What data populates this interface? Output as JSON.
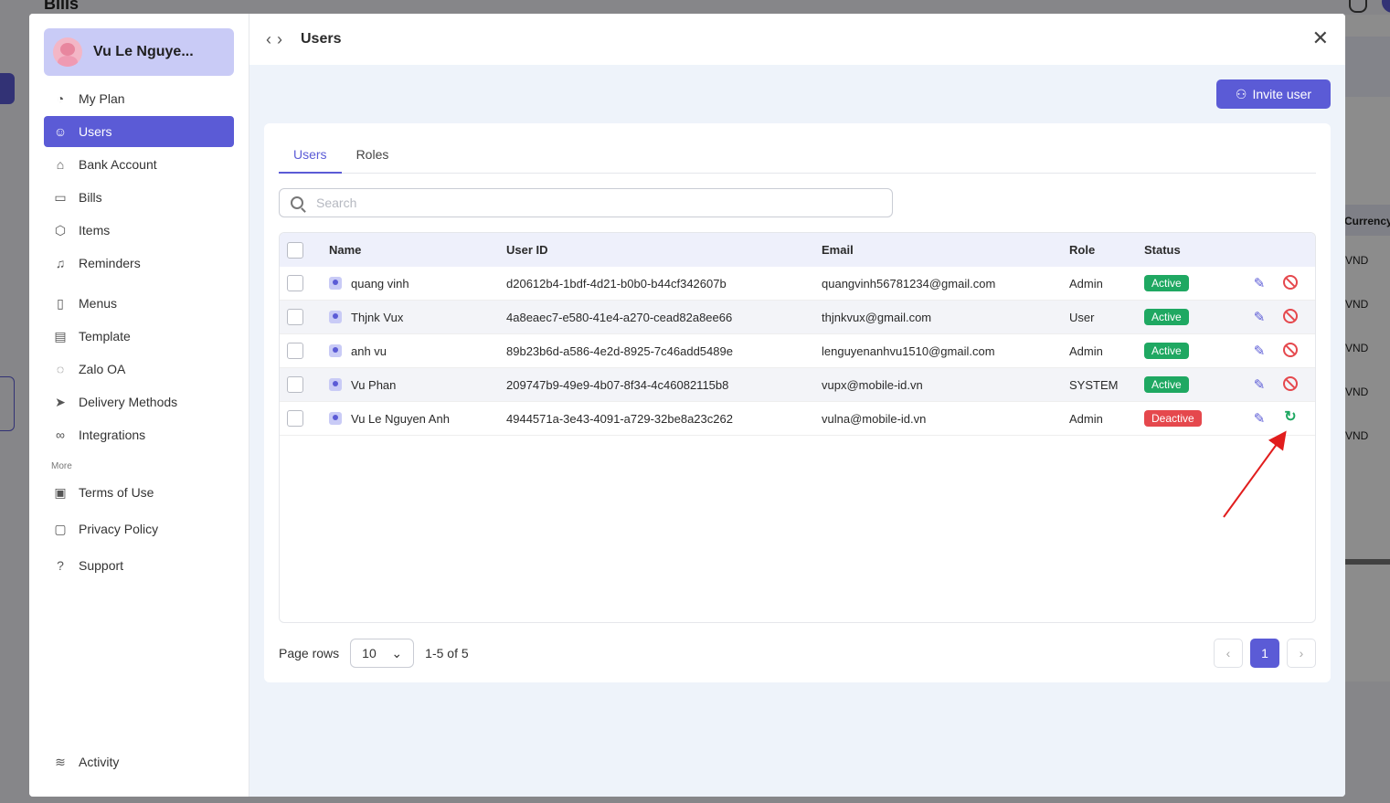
{
  "background": {
    "title": "Bills",
    "currency_header": "Currency",
    "currency_values": [
      "VND",
      "VND",
      "VND",
      "VND",
      "VND"
    ]
  },
  "profile": {
    "name": "Vu Le Nguye..."
  },
  "nav": {
    "items": [
      {
        "label": "My Plan",
        "icon": "pie-chart-icon"
      },
      {
        "label": "Users",
        "icon": "users-icon"
      },
      {
        "label": "Bank Account",
        "icon": "bank-icon"
      },
      {
        "label": "Bills",
        "icon": "bill-icon"
      },
      {
        "label": "Items",
        "icon": "box-icon"
      },
      {
        "label": "Reminders",
        "icon": "bell-icon"
      },
      {
        "label": "Menus",
        "icon": "menu-icon"
      },
      {
        "label": "Template",
        "icon": "template-icon"
      },
      {
        "label": "Zalo OA",
        "icon": "chat-icon"
      },
      {
        "label": "Delivery Methods",
        "icon": "send-icon"
      },
      {
        "label": "Integrations",
        "icon": "link-icon"
      }
    ],
    "more_label": "More",
    "more_items": [
      {
        "label": "Terms of Use",
        "icon": "clipboard-icon"
      },
      {
        "label": "Privacy Policy",
        "icon": "clipboard-icon"
      },
      {
        "label": "Support",
        "icon": "help-icon"
      }
    ],
    "bottom_item": {
      "label": "Activity",
      "icon": "layers-icon"
    }
  },
  "header": {
    "title": "Users"
  },
  "toolbar": {
    "invite_label": "Invite user"
  },
  "tabs": [
    {
      "label": "Users"
    },
    {
      "label": "Roles"
    }
  ],
  "search": {
    "placeholder": "Search",
    "value": ""
  },
  "table": {
    "columns": {
      "name": "Name",
      "user_id": "User ID",
      "email": "Email",
      "role": "Role",
      "status": "Status"
    },
    "rows": [
      {
        "name": "quang vinh",
        "user_id": "d20612b4-1bdf-4d21-b0b0-b44cf342607b",
        "email": "quangvinh56781234@gmail.com",
        "role": "Admin",
        "status": "Active"
      },
      {
        "name": "Thjnk Vux",
        "user_id": "4a8eaec7-e580-41e4-a270-cead82a8ee66",
        "email": "thjnkvux@gmail.com",
        "role": "User",
        "status": "Active"
      },
      {
        "name": "anh vu",
        "user_id": "89b23b6d-a586-4e2d-8925-7c46add5489e",
        "email": "lenguyenanhvu1510@gmail.com",
        "role": "Admin",
        "status": "Active"
      },
      {
        "name": "Vu Phan",
        "user_id": "209747b9-49e9-4b07-8f34-4c46082115b8",
        "email": "vupx@mobile-id.vn",
        "role": "SYSTEM",
        "status": "Active"
      },
      {
        "name": "Vu Le Nguyen Anh",
        "user_id": "4944571a-3e43-4091-a729-32be8a23c262",
        "email": "vulna@mobile-id.vn",
        "role": "Admin",
        "status": "Deactive"
      }
    ]
  },
  "pagination": {
    "rows_label": "Page rows",
    "rows_value": "10",
    "range": "1-5 of 5",
    "current_page": "1"
  },
  "colors": {
    "accent": "#5b5bd6",
    "active": "#1fa862",
    "deactive": "#e5484d"
  }
}
